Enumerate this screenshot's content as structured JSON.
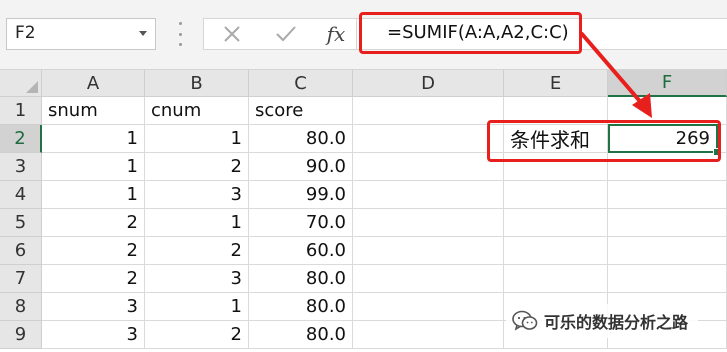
{
  "formula_bar": {
    "name_box": "F2",
    "fx_label": "fx",
    "formula": "=SUMIF(A:A,A2,C:C)"
  },
  "columns": [
    "A",
    "B",
    "C",
    "D",
    "E",
    "F"
  ],
  "rows": [
    "1",
    "2",
    "3",
    "4",
    "5",
    "6",
    "7",
    "8",
    "9"
  ],
  "cells": {
    "A1": "snum",
    "B1": "cnum",
    "C1": "score",
    "A2": "1",
    "B2": "1",
    "C2": "80.0",
    "A3": "1",
    "B3": "2",
    "C3": "90.0",
    "A4": "1",
    "B4": "3",
    "C4": "99.0",
    "A5": "2",
    "B5": "1",
    "C5": "70.0",
    "A6": "2",
    "B6": "2",
    "C6": "60.0",
    "A7": "2",
    "B7": "3",
    "C7": "80.0",
    "A8": "3",
    "B8": "1",
    "C8": "80.0",
    "A9": "3",
    "B9": "2",
    "C9": "80.0",
    "E2": "条件求和",
    "F2": "269"
  },
  "selected_cell": "F2",
  "colors": {
    "selection": "#217346",
    "annotation": "#e8201d"
  },
  "watermark": {
    "text": "可乐的数据分析之路",
    "icon": "wechat-icon"
  }
}
